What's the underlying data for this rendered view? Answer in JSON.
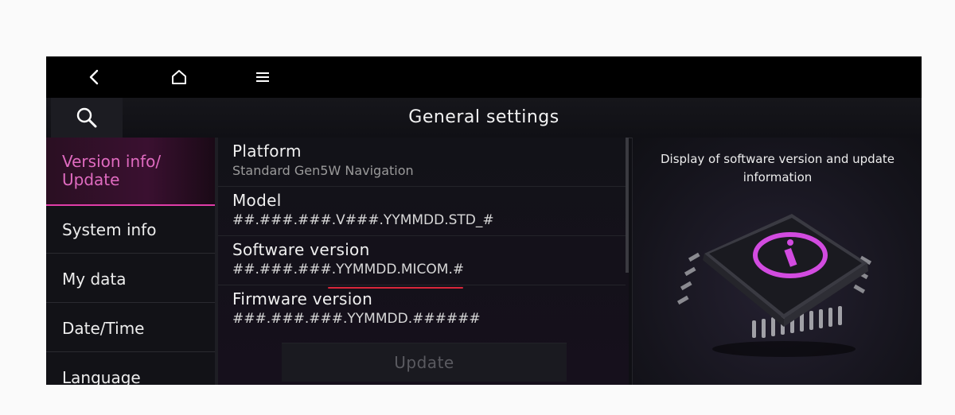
{
  "header": {
    "title": "General settings"
  },
  "topbar": {
    "icons": [
      "back-icon",
      "home-icon",
      "menu-icon"
    ]
  },
  "sidebar": {
    "items": [
      {
        "label_line1": "Version info/",
        "label_line2": "Update",
        "active": true
      },
      {
        "label": "System info"
      },
      {
        "label": "My data"
      },
      {
        "label": "Date/Time"
      },
      {
        "label": "Language"
      }
    ]
  },
  "content": {
    "rows": [
      {
        "title": "Platform",
        "value": "Standard Gen5W Navigation"
      },
      {
        "title": "Model",
        "value": "##.###.###.V###.YYMMDD.STD_#"
      },
      {
        "title": "Software version",
        "value": "##.###.###.YYMMDD.MICOM.#"
      },
      {
        "title": "Firmware version",
        "value": "###.###.###.YYMMDD.######"
      }
    ],
    "update_label": "Update"
  },
  "info_panel": {
    "description": "Display of software version and update information"
  },
  "colors": {
    "accent": "#e03da8",
    "highlight_underline": "#d8263a",
    "background": "#0f0f14"
  }
}
